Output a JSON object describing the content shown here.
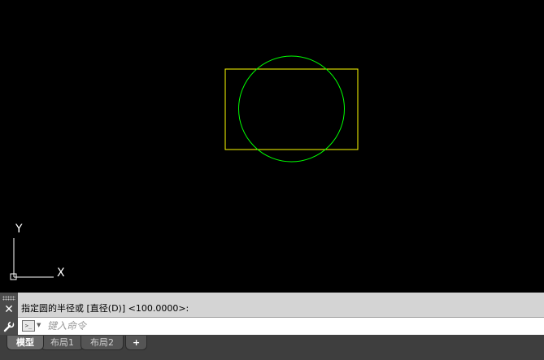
{
  "canvas": {
    "background": "#000000",
    "rectangle_color": "#ffff00",
    "circle_color": "#00ff00",
    "ucs_color": "#ffffff",
    "ucs": {
      "x_label": "X",
      "y_label": "Y"
    }
  },
  "command": {
    "history": "指定圆的半径或 [直径(D)] <100.0000>:",
    "input_value": "",
    "input_placeholder": "键入命令",
    "prompt_icon": "command-prompt-icon",
    "close_icon": "close-icon",
    "customize_icon": "wrench-icon"
  },
  "tabs": [
    {
      "label": "模型",
      "active": true
    },
    {
      "label": "布局1",
      "active": false
    },
    {
      "label": "布局2",
      "active": false
    }
  ],
  "add_tab_label": "+"
}
